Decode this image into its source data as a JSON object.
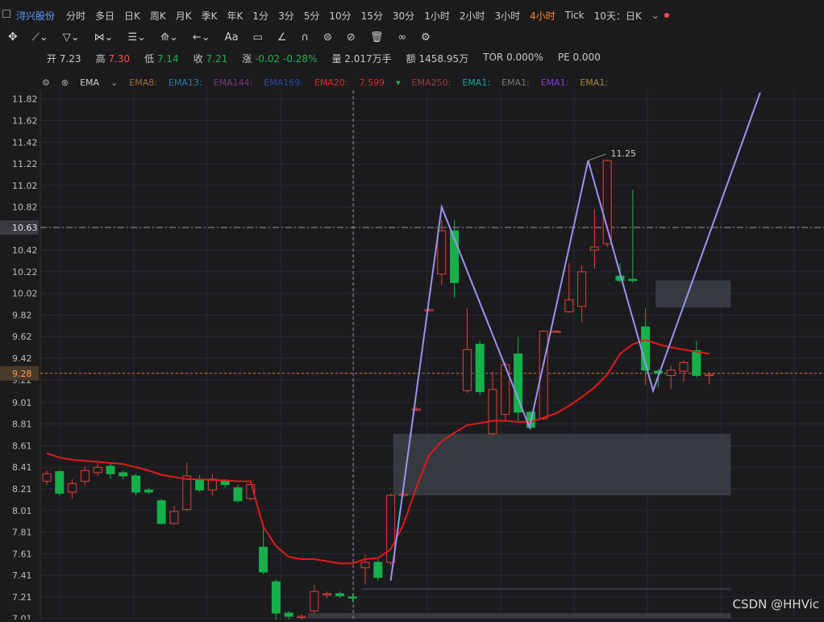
{
  "toolbar": {
    "stock_name": "浔兴股份",
    "timeframes": [
      "分时",
      "多日",
      "日K",
      "周K",
      "月K",
      "季K",
      "年K",
      "1分",
      "3分",
      "5分",
      "10分",
      "15分",
      "30分",
      "1小时",
      "2小时",
      "3小时",
      "4小时",
      "Tick",
      "10天：日K"
    ],
    "active_timeframe": "4小时"
  },
  "quote": {
    "open_label": "开",
    "open": "7.23",
    "high_label": "高",
    "high": "7.30",
    "low_label": "低",
    "low": "7.14",
    "close_label": "收",
    "close": "7.21",
    "change_label": "涨",
    "change": "-0.02",
    "change_pct": "-0.28%",
    "volume_label": "量",
    "volume": "2.017万手",
    "amount_label": "额",
    "amount": "1458.95万",
    "tor_label": "TOR",
    "tor": "0.000%",
    "pe_label": "PE",
    "pe": "0.000"
  },
  "ema_bar": {
    "label": "EMA",
    "items": [
      {
        "text": "EMA8:",
        "color": "#a06a3a"
      },
      {
        "text": "EMA13:",
        "color": "#2a7aa8"
      },
      {
        "text": "EMA144:",
        "color": "#7a3a7a"
      },
      {
        "text": "EMA169:",
        "color": "#2a4aa8"
      },
      {
        "text": "EMA20:",
        "color": "#e02a2a"
      },
      {
        "text": "7.599",
        "color": "#e02a2a"
      },
      {
        "text": "EMA250:",
        "color": "#a03a3a"
      },
      {
        "text": "EMA1:",
        "color": "#1aa89a"
      },
      {
        "text": "EMA1:",
        "color": "#7a7a7a"
      },
      {
        "text": "EMA1:",
        "color": "#8a3ad0"
      },
      {
        "text": "EMA1:",
        "color": "#a08a3a"
      }
    ]
  },
  "chart_data": {
    "type": "candlestick",
    "ylim": [
      7.0,
      11.9
    ],
    "y_ticks": [
      "11.82",
      "11.62",
      "11.42",
      "11.22",
      "11.02",
      "10.82",
      "10.63",
      "10.42",
      "10.22",
      "10.02",
      "9.82",
      "9.62",
      "9.42",
      "9.28",
      "9.22",
      "9.01",
      "8.81",
      "8.61",
      "8.41",
      "8.21",
      "8.01",
      "7.81",
      "7.61",
      "7.41",
      "7.21",
      "7.01"
    ],
    "marker_lines": [
      {
        "value": 10.63,
        "label": "10.63"
      },
      {
        "value": 9.28,
        "label": "9.28"
      }
    ],
    "peak_label": "11.25",
    "candles": [
      {
        "o": 8.28,
        "c": 8.35,
        "h": 8.38,
        "l": 8.25
      },
      {
        "o": 8.37,
        "c": 8.17,
        "h": 8.38,
        "l": 8.15
      },
      {
        "o": 8.18,
        "c": 8.26,
        "h": 8.3,
        "l": 8.12
      },
      {
        "o": 8.28,
        "c": 8.38,
        "h": 8.42,
        "l": 8.24
      },
      {
        "o": 8.36,
        "c": 8.41,
        "h": 8.45,
        "l": 8.33
      },
      {
        "o": 8.42,
        "c": 8.35,
        "h": 8.45,
        "l": 8.3
      },
      {
        "o": 8.36,
        "c": 8.33,
        "h": 8.38,
        "l": 8.3
      },
      {
        "o": 8.33,
        "c": 8.18,
        "h": 8.35,
        "l": 8.15
      },
      {
        "o": 8.2,
        "c": 8.18,
        "h": 8.22,
        "l": 8.16
      },
      {
        "o": 8.1,
        "c": 7.89,
        "h": 8.12,
        "l": 7.88
      },
      {
        "o": 7.89,
        "c": 8.0,
        "h": 8.05,
        "l": 7.88
      },
      {
        "o": 8.02,
        "c": 8.33,
        "h": 8.45,
        "l": 8.0
      },
      {
        "o": 8.3,
        "c": 8.2,
        "h": 8.34,
        "l": 8.18
      },
      {
        "o": 8.2,
        "c": 8.3,
        "h": 8.35,
        "l": 8.15
      },
      {
        "o": 8.28,
        "c": 8.25,
        "h": 8.3,
        "l": 8.22
      },
      {
        "o": 8.22,
        "c": 8.1,
        "h": 8.25,
        "l": 8.08
      },
      {
        "o": 8.12,
        "c": 8.25,
        "h": 8.28,
        "l": 8.1
      },
      {
        "o": 7.67,
        "c": 7.44,
        "h": 7.85,
        "l": 7.42
      },
      {
        "o": 7.35,
        "c": 7.06,
        "h": 7.37,
        "l": 6.98
      },
      {
        "o": 7.06,
        "c": 7.03,
        "h": 7.08,
        "l": 6.95
      },
      {
        "o": 7.03,
        "c": 7.03,
        "h": 7.05,
        "l": 6.98
      },
      {
        "o": 7.08,
        "c": 7.26,
        "h": 7.32,
        "l": 7.05
      },
      {
        "o": 7.24,
        "c": 7.24,
        "h": 7.26,
        "l": 7.2
      },
      {
        "o": 7.24,
        "c": 7.22,
        "h": 7.26,
        "l": 7.2
      },
      {
        "o": 7.21,
        "c": 7.2,
        "h": 7.24,
        "l": 7.16
      },
      {
        "o": 7.48,
        "c": 7.53,
        "h": 7.6,
        "l": 7.33
      },
      {
        "o": 7.53,
        "c": 7.39,
        "h": 7.56,
        "l": 7.36
      },
      {
        "o": 7.53,
        "c": 8.15,
        "h": 8.17,
        "l": 7.5
      },
      {
        "o": 8.16,
        "c": 8.16,
        "h": 8.18,
        "l": 8.14
      },
      {
        "o": 8.95,
        "c": 8.95,
        "h": 8.97,
        "l": 8.93
      },
      {
        "o": 9.87,
        "c": 9.87,
        "h": 9.88,
        "l": 9.86
      },
      {
        "o": 10.2,
        "c": 10.6,
        "h": 10.7,
        "l": 10.1
      },
      {
        "o": 10.6,
        "c": 10.12,
        "h": 10.7,
        "l": 9.98
      },
      {
        "o": 9.12,
        "c": 9.5,
        "h": 9.88,
        "l": 9.1
      },
      {
        "o": 9.55,
        "c": 9.11,
        "h": 9.58,
        "l": 9.08
      },
      {
        "o": 8.72,
        "c": 9.13,
        "h": 9.3,
        "l": 8.7
      },
      {
        "o": 8.9,
        "c": 9.36,
        "h": 9.38,
        "l": 8.85
      },
      {
        "o": 9.46,
        "c": 8.92,
        "h": 9.62,
        "l": 8.82
      },
      {
        "o": 8.92,
        "c": 8.78,
        "h": 8.93,
        "l": 8.76
      },
      {
        "o": 8.86,
        "c": 9.67,
        "h": 9.68,
        "l": 8.85
      },
      {
        "o": 9.67,
        "c": 9.67,
        "h": 9.68,
        "l": 9.66
      },
      {
        "o": 9.85,
        "c": 9.96,
        "h": 10.3,
        "l": 9.84
      },
      {
        "o": 9.9,
        "c": 10.22,
        "h": 10.28,
        "l": 9.75
      },
      {
        "o": 10.42,
        "c": 10.45,
        "h": 10.8,
        "l": 10.25
      },
      {
        "o": 10.48,
        "c": 11.25,
        "h": 11.26,
        "l": 10.45
      },
      {
        "o": 10.18,
        "c": 10.14,
        "h": 10.3,
        "l": 10.12
      },
      {
        "o": 10.15,
        "c": 10.14,
        "h": 10.98,
        "l": 10.12
      },
      {
        "o": 9.71,
        "c": 9.31,
        "h": 9.88,
        "l": 9.17
      },
      {
        "o": 9.3,
        "c": 9.28,
        "h": 9.32,
        "l": 9.15
      },
      {
        "o": 9.26,
        "c": 9.31,
        "h": 9.35,
        "l": 9.13
      },
      {
        "o": 9.3,
        "c": 9.38,
        "h": 9.4,
        "l": 9.2
      },
      {
        "o": 9.49,
        "c": 9.26,
        "h": 9.58,
        "l": 9.24
      },
      {
        "o": 9.26,
        "c": 9.27,
        "h": 9.29,
        "l": 9.18
      }
    ],
    "ema20": [
      8.54,
      8.5,
      8.48,
      8.47,
      8.46,
      8.45,
      8.44,
      8.41,
      8.38,
      8.34,
      8.32,
      8.3,
      8.3,
      8.29,
      8.29,
      8.28,
      8.28,
      7.86,
      7.68,
      7.58,
      7.56,
      7.56,
      7.54,
      7.52,
      7.52,
      7.56,
      7.57,
      7.65,
      7.88,
      8.22,
      8.52,
      8.65,
      8.73,
      8.8,
      8.82,
      8.84,
      8.84,
      8.83,
      8.83,
      8.87,
      8.91,
      8.98,
      9.06,
      9.15,
      9.27,
      9.46,
      9.55,
      9.59,
      9.55,
      9.52,
      9.5,
      9.48,
      9.46
    ],
    "zigzag": [
      [
        27.0,
        7.36
      ],
      [
        31.0,
        10.82
      ],
      [
        37.9,
        8.78
      ],
      [
        42.5,
        11.25
      ],
      [
        47.6,
        9.12
      ],
      [
        56.0,
        11.88
      ]
    ],
    "zones": [
      {
        "x0": 27.2,
        "x1": 53.7,
        "y0": 8.15,
        "y1": 8.72
      },
      {
        "x0": 47.8,
        "x1": 53.7,
        "y0": 9.89,
        "y1": 10.14
      },
      {
        "x0": 24.7,
        "x1": 53.7,
        "y0": 7.28,
        "y1": 7.29
      },
      {
        "x0": 20.5,
        "x1": 53.7,
        "y0": 7.01,
        "y1": 7.06
      }
    ]
  },
  "watermark": "CSDN @HHVic"
}
